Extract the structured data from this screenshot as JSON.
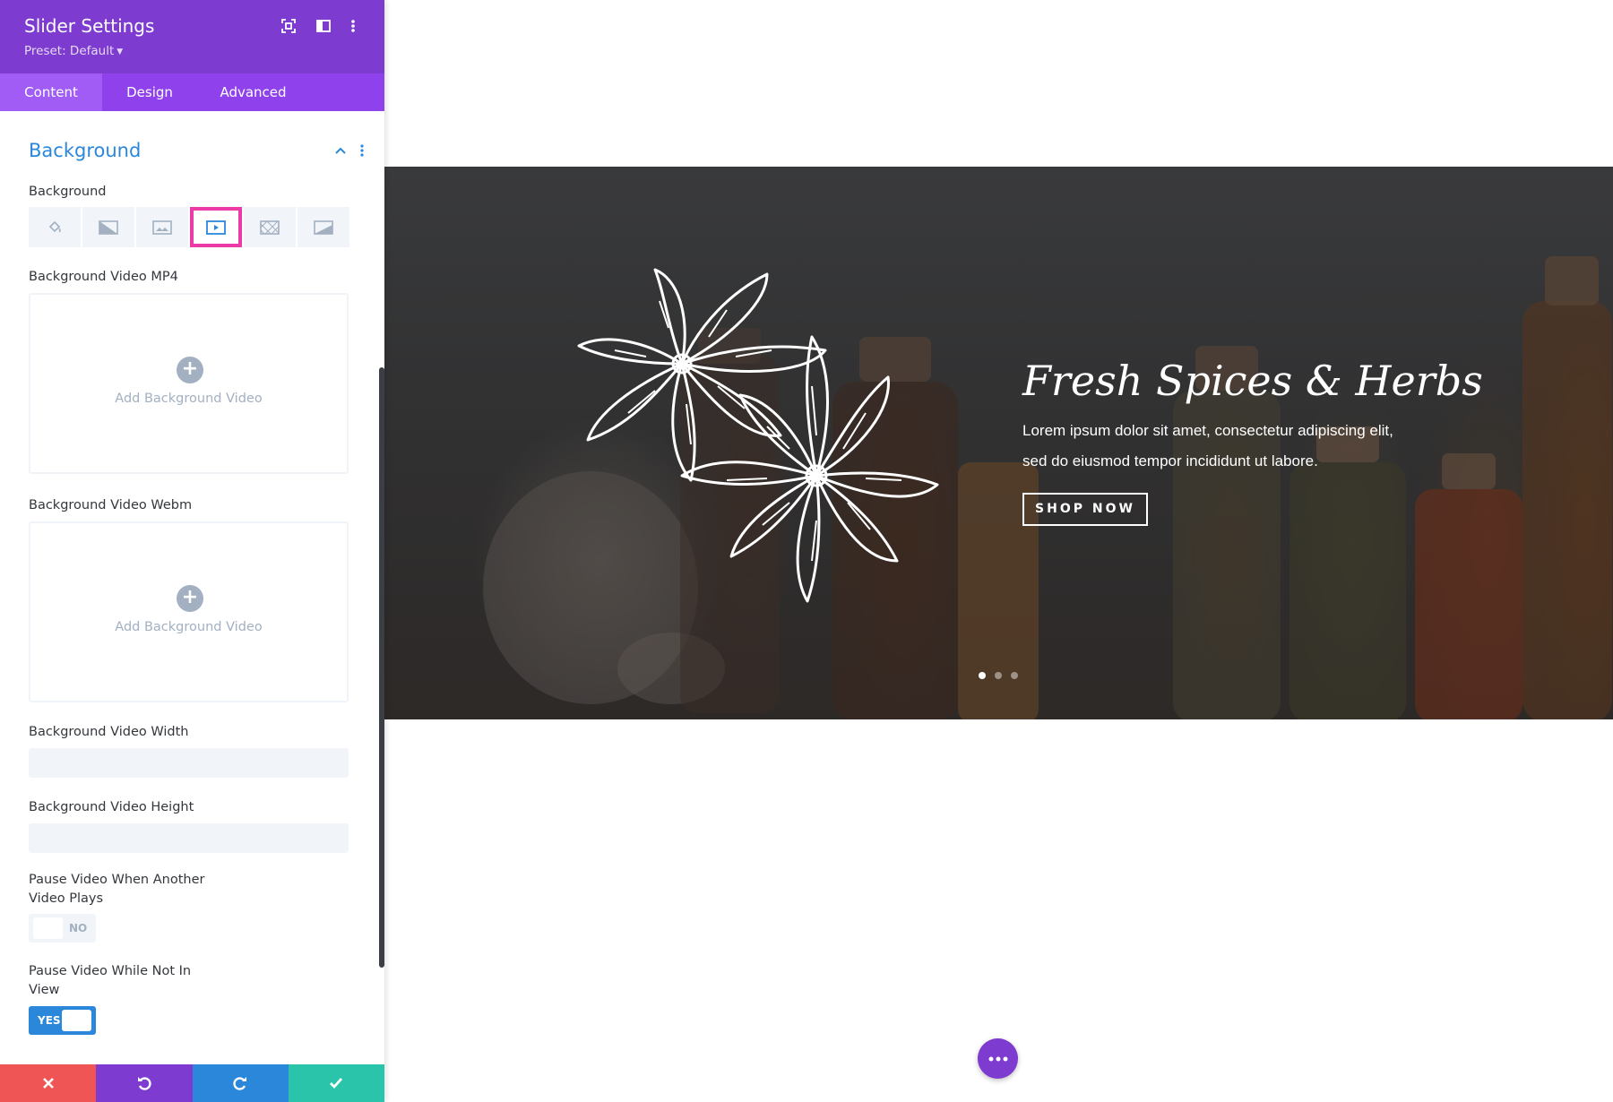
{
  "panel": {
    "title": "Slider Settings",
    "preset": "Preset: Default",
    "tabs": [
      {
        "label": "Content",
        "active": true
      },
      {
        "label": "Design",
        "active": false
      },
      {
        "label": "Advanced",
        "active": false
      }
    ],
    "section": {
      "title": "Background",
      "background_label": "Background",
      "background_types": [
        {
          "icon": "paint-bucket-icon",
          "active": false
        },
        {
          "icon": "gradient-icon",
          "active": false
        },
        {
          "icon": "image-icon",
          "active": false
        },
        {
          "icon": "video-icon",
          "active": true
        },
        {
          "icon": "pattern-icon",
          "active": false
        },
        {
          "icon": "mask-icon",
          "active": false
        }
      ],
      "video_mp4_label": "Background Video MP4",
      "video_webm_label": "Background Video Webm",
      "add_video_label": "Add Background Video",
      "video_width_label": "Background Video Width",
      "video_width_value": "",
      "video_height_label": "Background Video Height",
      "video_height_value": "",
      "pause_other_label_1": "Pause Video When Another",
      "pause_other_label_2": "Video Plays",
      "pause_other_value": "NO",
      "pause_view_label_1": "Pause Video While Not In",
      "pause_view_label_2": "View",
      "pause_view_value": "YES"
    },
    "actions": [
      {
        "name": "discard",
        "icon": "close-icon",
        "color": "#ef5555"
      },
      {
        "name": "undo",
        "icon": "undo-icon",
        "color": "#7e3bd0"
      },
      {
        "name": "redo",
        "icon": "redo-icon",
        "color": "#2b87da"
      },
      {
        "name": "save",
        "icon": "check-icon",
        "color": "#29c4a9"
      }
    ]
  },
  "slide": {
    "title": "Fresh Spices & Herbs",
    "body_line_1": "Lorem ipsum dolor sit amet, consectetur adipiscing elit,",
    "body_line_2": "sed do eiusmod tempor incididunt ut labore.",
    "button_label": "SHOP NOW",
    "dots": 3,
    "active_dot": 1
  },
  "colors": {
    "panel_header": "#7e3bd0",
    "tab_bar": "#8f42ec",
    "accent_blue": "#2b87da",
    "highlight_pink": "#ec3aa6"
  }
}
